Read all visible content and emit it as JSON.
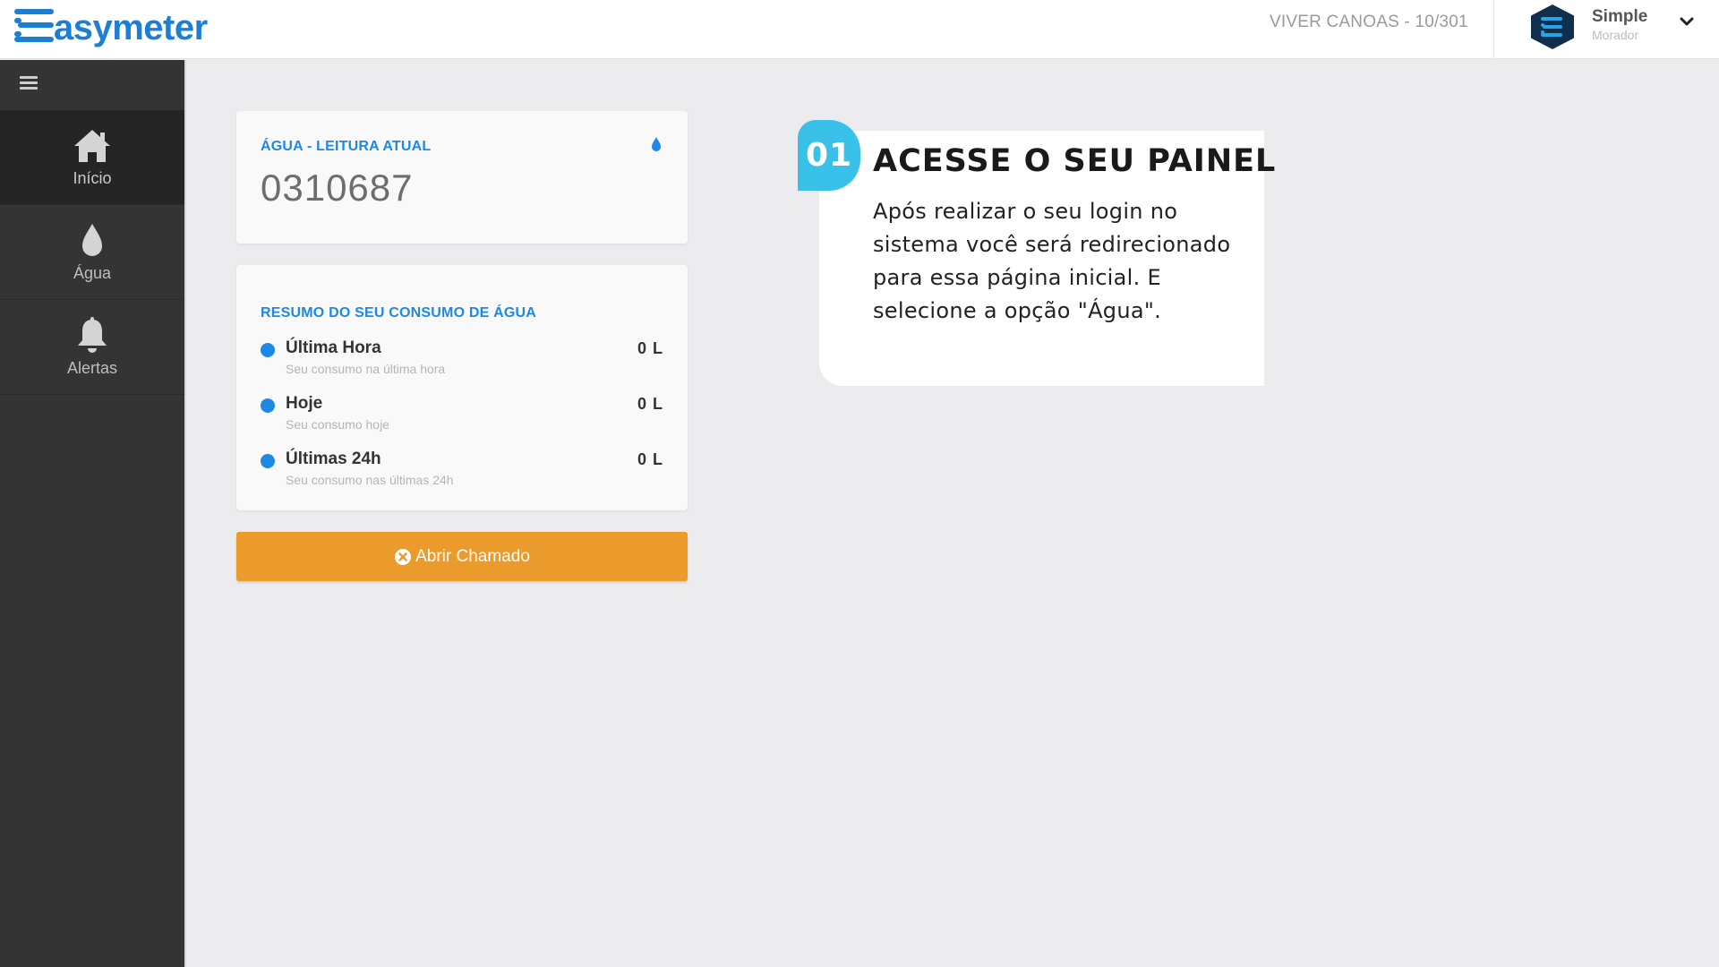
{
  "header": {
    "logo_text": "asymeter",
    "building": "VIVER CANOAS - 10/301",
    "user_name": "Simple",
    "user_role": "Morador"
  },
  "sidebar": {
    "items": [
      {
        "label": "Início",
        "icon": "home-icon",
        "active": true
      },
      {
        "label": "Água",
        "icon": "water-drop-icon",
        "active": false
      },
      {
        "label": "Alertas",
        "icon": "bell-icon",
        "active": false
      }
    ]
  },
  "reading_card": {
    "title": "ÁGUA - LEITURA ATUAL",
    "value": "0310687"
  },
  "summary_card": {
    "title": "RESUMO DO SEU CONSUMO DE ÁGUA",
    "rows": [
      {
        "label": "Última Hora",
        "sub": "Seu consumo na última hora",
        "value": "0 L"
      },
      {
        "label": "Hoje",
        "sub": "Seu consumo hoje",
        "value": "0 L"
      },
      {
        "label": "Últimas 24h",
        "sub": "Seu consumo nas últimas 24h",
        "value": "0 L"
      }
    ]
  },
  "ticket_button": {
    "label": "Abrir Chamado"
  },
  "callout": {
    "step": "01",
    "title": "ACESSE O SEU PAINEL",
    "body": "Após realizar o seu login no sistema você será redirecionado para essa página inicial.  E selecione a opção \"Água\"."
  },
  "colors": {
    "accent_blue": "#1e88e5",
    "sidebar_bg": "#343434",
    "button_orange": "#eb9a2c",
    "badge_cyan": "#39c1ea"
  }
}
